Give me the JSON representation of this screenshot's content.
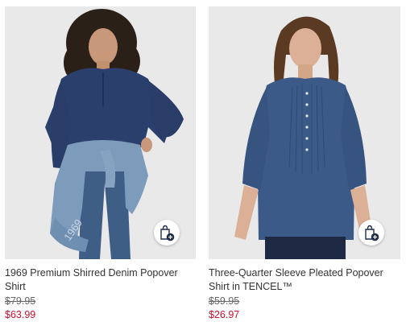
{
  "products": [
    {
      "title": "1969 Premium Shirred Denim Popover Shirt",
      "original_price": "$79.95",
      "sale_price": "$63.99",
      "image_icon": "model-denim-popover-photo"
    },
    {
      "title": "Three-Quarter Sleeve Pleated Popover Shirt in TENCEL™",
      "original_price": "$59.95",
      "sale_price": "$26.97",
      "image_icon": "model-pleated-popover-photo"
    }
  ],
  "quick_add_icon": "shopping-bag-plus-icon",
  "colors": {
    "sale_price": "#c8102e",
    "title_text": "#333333",
    "icon_navy": "#1f2d4d",
    "photo_background": "#e9e9ea"
  }
}
